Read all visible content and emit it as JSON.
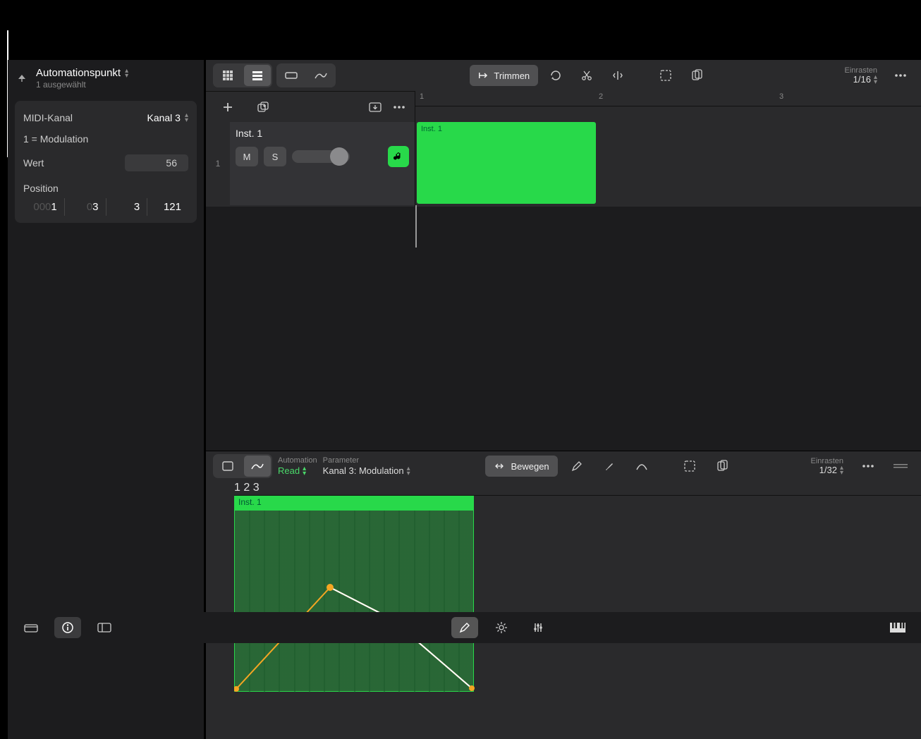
{
  "inspector": {
    "title": "Automationspunkt",
    "subtitle": "1 ausgewählt",
    "midi_channel_label": "MIDI-Kanal",
    "midi_channel_value": "Kanal 3",
    "param_name": "1 = Modulation",
    "wert_label": "Wert",
    "wert_value": "56",
    "position_label": "Position",
    "position": {
      "bars": "0001",
      "beats": "03",
      "div": "3",
      "ticks": "121"
    }
  },
  "top_toolbar": {
    "trim_label": "Trimmen",
    "snap_label": "Einrasten",
    "snap_value": "1/16"
  },
  "ruler": {
    "ticks": [
      "1",
      "2",
      "3"
    ]
  },
  "track": {
    "index": "1",
    "name": "Inst. 1",
    "mute": "M",
    "solo": "S",
    "clip_name": "Inst. 1"
  },
  "editor_toolbar": {
    "automation_label": "Automation",
    "automation_value": "Read",
    "parameter_label": "Parameter",
    "parameter_value": "Kanal 3: Modulation",
    "move_label": "Bewegen",
    "snap_label": "Einrasten",
    "snap_value": "1/32"
  },
  "editor_ruler": {
    "ticks": [
      "1",
      "2",
      "3"
    ]
  },
  "editor": {
    "clip_name": "Inst. 1"
  },
  "icons": {
    "grid": "grid-icon",
    "list": "list-icon",
    "region": "region-icon",
    "automation": "automation-icon",
    "loop": "loop-icon",
    "scissors": "scissors-icon",
    "splitjoin": "splitjoin-icon",
    "select": "select-icon",
    "paste": "paste-icon",
    "more": "more-icon",
    "add": "add-icon",
    "addcopy": "add-copy-icon",
    "import": "import-icon",
    "music": "music-icon",
    "marquee": "marquee-tool-icon",
    "pencil": "pencil-icon",
    "brush": "brush-icon",
    "curve": "curve-icon"
  }
}
